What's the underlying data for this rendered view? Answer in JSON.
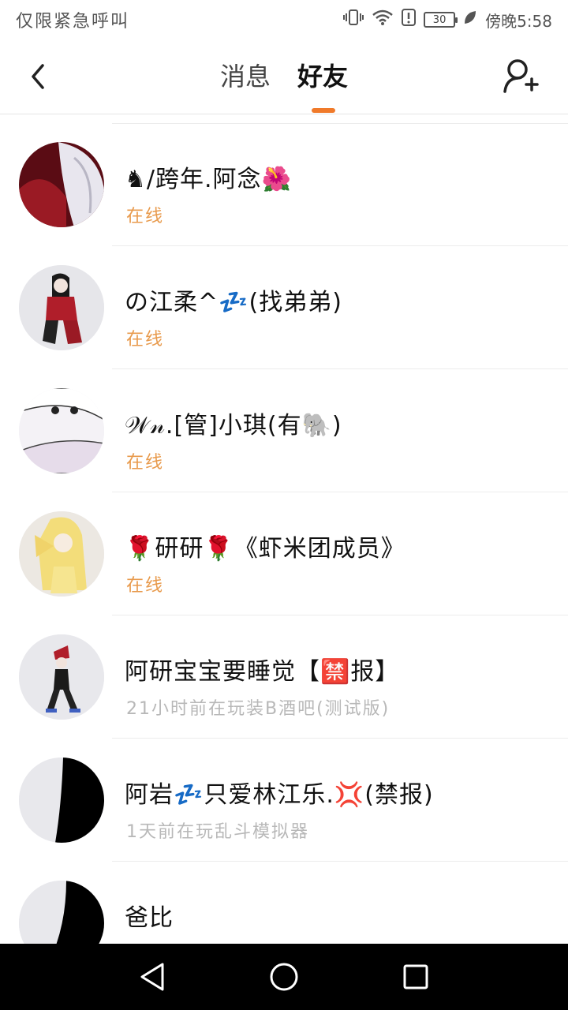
{
  "status_bar": {
    "left_text": "仅限紧急呼叫",
    "battery": "30",
    "carrier_time": "傍晚5:58"
  },
  "header": {
    "tabs": [
      {
        "label": "消息"
      },
      {
        "label": "好友"
      }
    ],
    "active_tab": 1,
    "accent_color": "#f07a2a"
  },
  "friends": [
    {
      "name": "♞/跨年.阿念🌺",
      "status": "在线",
      "online": true
    },
    {
      "name": "の江柔^💤(找弟弟)",
      "status": "在线",
      "online": true
    },
    {
      "name": "𝒲𝓃.[管]小琪(有🐘)",
      "status": "在线",
      "online": true
    },
    {
      "name": "🌹研研🌹《虾米团成员》",
      "status": "在线",
      "online": true
    },
    {
      "name": "阿研宝宝要睡觉【🈲报】",
      "status": "21小时前在玩装B酒吧(测试版)",
      "online": false
    },
    {
      "name": "阿岩💤只爱林江乐.💢(禁报)",
      "status": "1天前在玩乱斗模拟器",
      "online": false
    },
    {
      "name": "爸比",
      "status": "",
      "online": false
    }
  ],
  "colors": {
    "online": "#e89a4c",
    "offline": "#b8b8b8"
  }
}
